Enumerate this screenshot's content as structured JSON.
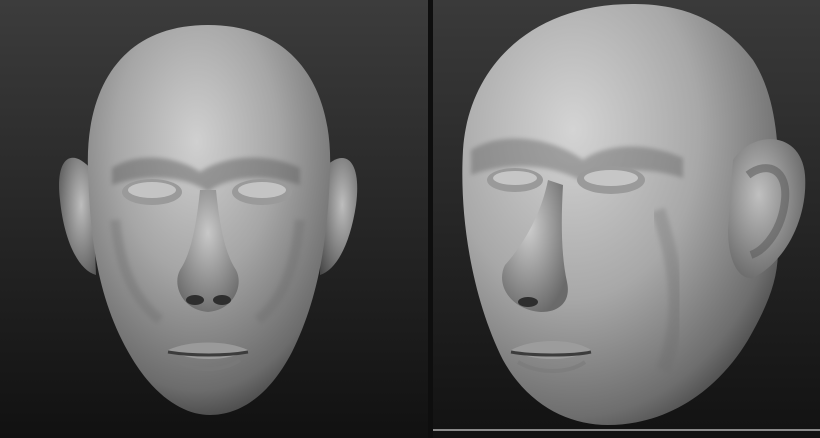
{
  "scene": {
    "description_visible_text": "",
    "panels": [
      {
        "view": "front"
      },
      {
        "view": "three-quarter"
      }
    ],
    "colors": {
      "bg_top": "#3a3a3a",
      "bg_bottom": "#121212",
      "divider": "#101010",
      "skin_light": "#c8c8c8",
      "skin_mid": "#8c8c8c",
      "skin_dark": "#3c3c3c"
    }
  }
}
